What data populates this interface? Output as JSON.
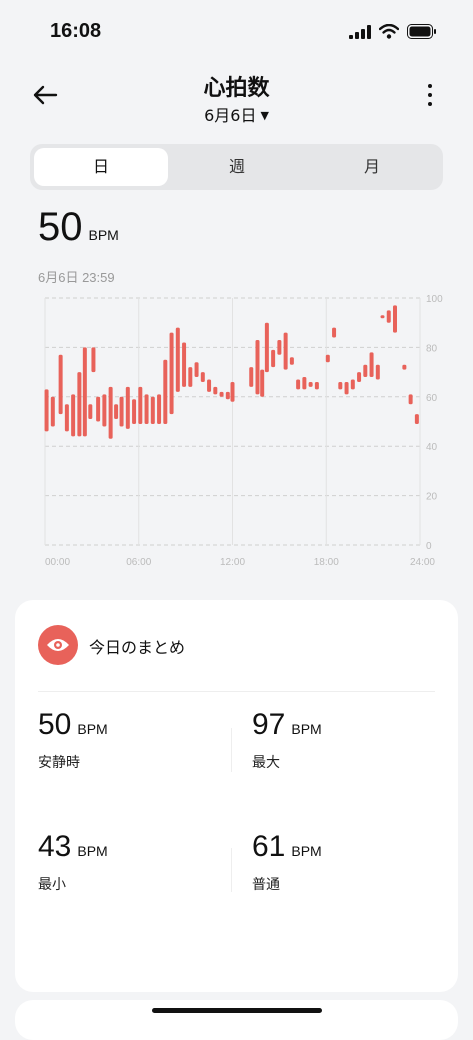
{
  "status_bar": {
    "time": "16:08"
  },
  "header": {
    "title": "心拍数",
    "date": "6月6日"
  },
  "tabs": [
    {
      "label": "日",
      "active": true
    },
    {
      "label": "週",
      "active": false
    },
    {
      "label": "月",
      "active": false
    }
  ],
  "current": {
    "value": "50",
    "unit": "BPM",
    "timestamp": "6月6日 23:59"
  },
  "chart_data": {
    "type": "bar",
    "subtype": "range",
    "x_ticks": [
      "00:00",
      "06:00",
      "12:00",
      "18:00",
      "24:00"
    ],
    "y_ticks": [
      "0",
      "20",
      "40",
      "60",
      "80",
      "100"
    ],
    "ylim": [
      0,
      100
    ],
    "xlim": [
      0,
      24
    ],
    "grid": true,
    "color": "#e8625a",
    "ranges": [
      {
        "x": 0.1,
        "low": 46,
        "high": 63
      },
      {
        "x": 0.5,
        "low": 48,
        "high": 60
      },
      {
        "x": 1.0,
        "low": 53,
        "high": 77
      },
      {
        "x": 1.4,
        "low": 46,
        "high": 57
      },
      {
        "x": 1.8,
        "low": 44,
        "high": 61
      },
      {
        "x": 2.2,
        "low": 44,
        "high": 70
      },
      {
        "x": 2.55,
        "low": 44,
        "high": 80
      },
      {
        "x": 2.9,
        "low": 51,
        "high": 57
      },
      {
        "x": 3.1,
        "low": 70,
        "high": 80
      },
      {
        "x": 3.4,
        "low": 50,
        "high": 60
      },
      {
        "x": 3.8,
        "low": 48,
        "high": 61
      },
      {
        "x": 4.2,
        "low": 43,
        "high": 64
      },
      {
        "x": 4.55,
        "low": 51,
        "high": 57
      },
      {
        "x": 4.9,
        "low": 48,
        "high": 60
      },
      {
        "x": 5.3,
        "low": 47,
        "high": 64
      },
      {
        "x": 5.7,
        "low": 49,
        "high": 59
      },
      {
        "x": 6.1,
        "low": 49,
        "high": 64
      },
      {
        "x": 6.5,
        "low": 49,
        "high": 61
      },
      {
        "x": 6.9,
        "low": 49,
        "high": 60
      },
      {
        "x": 7.3,
        "low": 49,
        "high": 61
      },
      {
        "x": 7.7,
        "low": 49,
        "high": 75
      },
      {
        "x": 8.1,
        "low": 53,
        "high": 86
      },
      {
        "x": 8.5,
        "low": 62,
        "high": 88
      },
      {
        "x": 8.9,
        "low": 64,
        "high": 82
      },
      {
        "x": 9.3,
        "low": 64,
        "high": 72
      },
      {
        "x": 9.7,
        "low": 68,
        "high": 74
      },
      {
        "x": 10.1,
        "low": 66,
        "high": 70
      },
      {
        "x": 10.5,
        "low": 62,
        "high": 67
      },
      {
        "x": 10.9,
        "low": 61,
        "high": 64
      },
      {
        "x": 11.3,
        "low": 60,
        "high": 62
      },
      {
        "x": 11.7,
        "low": 59,
        "high": 62
      },
      {
        "x": 12.0,
        "low": 58,
        "high": 66
      },
      {
        "x": 13.2,
        "low": 64,
        "high": 72
      },
      {
        "x": 13.6,
        "low": 61,
        "high": 83
      },
      {
        "x": 13.9,
        "low": 60,
        "high": 71
      },
      {
        "x": 14.2,
        "low": 70,
        "high": 90
      },
      {
        "x": 14.6,
        "low": 72,
        "high": 79
      },
      {
        "x": 15.0,
        "low": 77,
        "high": 83
      },
      {
        "x": 15.4,
        "low": 71,
        "high": 86
      },
      {
        "x": 15.8,
        "low": 73,
        "high": 76
      },
      {
        "x": 16.2,
        "low": 63,
        "high": 67
      },
      {
        "x": 16.6,
        "low": 63,
        "high": 68
      },
      {
        "x": 17.0,
        "low": 64,
        "high": 66
      },
      {
        "x": 17.4,
        "low": 63,
        "high": 66
      },
      {
        "x": 18.1,
        "low": 74,
        "high": 77
      },
      {
        "x": 18.5,
        "low": 84,
        "high": 88
      },
      {
        "x": 18.9,
        "low": 63,
        "high": 66
      },
      {
        "x": 19.3,
        "low": 61,
        "high": 66
      },
      {
        "x": 19.7,
        "low": 63,
        "high": 67
      },
      {
        "x": 20.1,
        "low": 66,
        "high": 70
      },
      {
        "x": 20.5,
        "low": 68,
        "high": 73
      },
      {
        "x": 20.9,
        "low": 68,
        "high": 78
      },
      {
        "x": 21.3,
        "low": 67,
        "high": 73
      },
      {
        "x": 21.6,
        "low": 92,
        "high": 93
      },
      {
        "x": 22.0,
        "low": 90,
        "high": 95
      },
      {
        "x": 22.4,
        "low": 86,
        "high": 97
      },
      {
        "x": 23.0,
        "low": 71,
        "high": 73
      },
      {
        "x": 23.4,
        "low": 57,
        "high": 61
      },
      {
        "x": 23.8,
        "low": 49,
        "high": 53
      }
    ]
  },
  "summary": {
    "title": "今日のまとめ",
    "resting": {
      "value": "50",
      "unit": "BPM",
      "label": "安静時"
    },
    "max": {
      "value": "97",
      "unit": "BPM",
      "label": "最大"
    },
    "min": {
      "value": "43",
      "unit": "BPM",
      "label": "最小"
    },
    "avg": {
      "value": "61",
      "unit": "BPM",
      "label": "普通"
    }
  }
}
